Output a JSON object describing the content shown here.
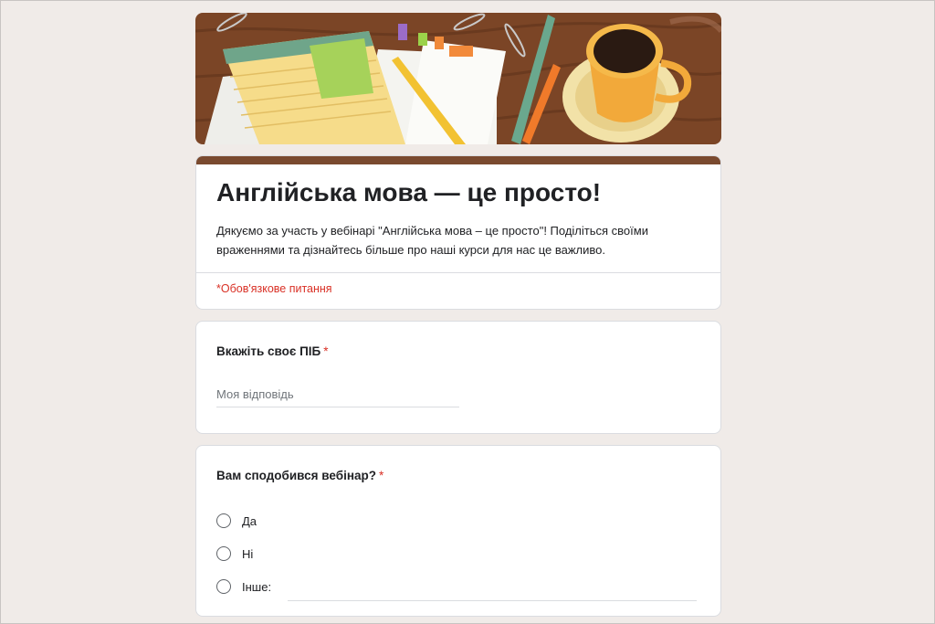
{
  "form": {
    "title": "Англійська мова — це просто!",
    "description": "Дякуємо за участь у вебінарі \"Англійська мова – це просто\"! Поділіться своїми враженнями та дізнайтесь більше про наші курси для нас це важливо.",
    "required_note": "*Обов'язкове питання"
  },
  "questions": [
    {
      "title": "Вкажіть своє ПІБ",
      "required_mark": "*",
      "placeholder": "Моя відповідь"
    },
    {
      "title": "Вам сподобився вебінар?",
      "required_mark": "*",
      "options": [
        "Да",
        "Ні",
        "Інше:"
      ]
    }
  ],
  "colors": {
    "theme": "#7a4a2f",
    "required": "#d93025",
    "background": "#f0ebe8"
  },
  "icons": [
    "radio-button-icon"
  ]
}
